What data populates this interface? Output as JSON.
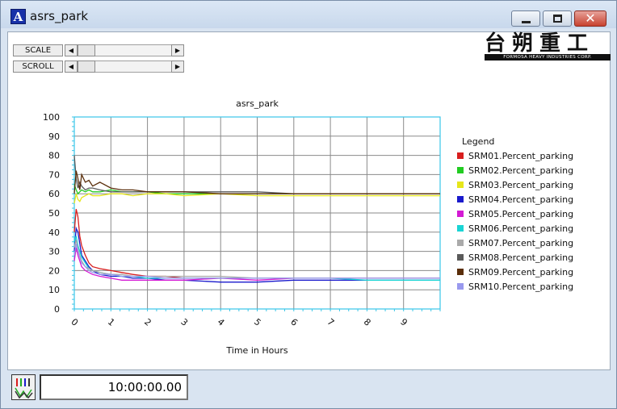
{
  "window": {
    "title": "asrs_park"
  },
  "controls": {
    "scale_label": "SCALE",
    "scroll_label": "SCROLL"
  },
  "logo": {
    "cjk": "台朔重工",
    "en": "FORMOSA HEAVY INDUSTRIES CORP."
  },
  "status": {
    "time": "10:00:00.00"
  },
  "colors": {
    "titlebar": "#c8d8ec",
    "plot_border": "#39c6e8",
    "close_button": "#c8422f"
  },
  "chart_data": {
    "type": "line",
    "title": "asrs_park",
    "xlabel": "Time in Hours",
    "ylabel": "",
    "xlim": [
      0,
      10
    ],
    "ylim": [
      0,
      100
    ],
    "x_ticks": [
      "0",
      "1",
      "2",
      "3",
      "4",
      "5",
      "6",
      "7",
      "8",
      "9"
    ],
    "y_ticks": [
      "0",
      "10",
      "20",
      "30",
      "40",
      "50",
      "60",
      "70",
      "80",
      "90",
      "100"
    ],
    "grid": true,
    "legend": {
      "title": "Legend",
      "placement": "right"
    },
    "x": [
      0,
      0.05,
      0.1,
      0.15,
      0.2,
      0.3,
      0.4,
      0.5,
      0.7,
      1.0,
      1.3,
      1.6,
      2.0,
      2.5,
      3.0,
      4.0,
      5.0,
      6.0,
      7.0,
      8.0,
      9.0,
      10.0
    ],
    "series": [
      {
        "name": "SRM01.Percent_parking",
        "color": "#d81e1e",
        "values": [
          40,
          52,
          48,
          38,
          33,
          28,
          24,
          22,
          21,
          20,
          19,
          18,
          17,
          17,
          16,
          16,
          16,
          16,
          16,
          16,
          16,
          16
        ]
      },
      {
        "name": "SRM02.Percent_parking",
        "color": "#22cc22",
        "values": [
          65,
          62,
          60,
          61,
          62,
          61,
          62,
          61,
          61,
          62,
          61,
          61,
          61,
          60,
          60,
          60,
          60,
          60,
          60,
          60,
          60,
          60
        ]
      },
      {
        "name": "SRM03.Percent_parking",
        "color": "#e6e61a",
        "values": [
          55,
          60,
          57,
          56,
          58,
          59,
          60,
          59,
          59,
          60,
          60,
          59,
          60,
          60,
          59,
          60,
          59,
          59,
          59,
          59,
          59,
          59
        ]
      },
      {
        "name": "SRM04.Percent_parking",
        "color": "#1a1acc",
        "values": [
          30,
          42,
          40,
          34,
          28,
          25,
          22,
          20,
          18,
          17,
          17,
          16,
          16,
          15,
          15,
          14,
          14,
          15,
          15,
          15,
          15,
          15
        ]
      },
      {
        "name": "SRM05.Percent_parking",
        "color": "#d41ad4",
        "values": [
          25,
          32,
          28,
          25,
          22,
          20,
          19,
          18,
          17,
          16,
          15,
          15,
          15,
          15,
          15,
          16,
          15,
          16,
          16,
          16,
          16,
          16
        ]
      },
      {
        "name": "SRM06.Percent_parking",
        "color": "#1ad4d4",
        "values": [
          35,
          38,
          33,
          30,
          27,
          24,
          21,
          20,
          19,
          18,
          17,
          17,
          16,
          16,
          16,
          16,
          16,
          16,
          16,
          15,
          15,
          15
        ]
      },
      {
        "name": "SRM07.Percent_parking",
        "color": "#aaaaaa",
        "values": [
          32,
          36,
          31,
          28,
          25,
          22,
          21,
          20,
          19,
          18,
          18,
          17,
          17,
          17,
          17,
          17,
          16,
          16,
          16,
          16,
          16,
          16
        ]
      },
      {
        "name": "SRM08.Percent_parking",
        "color": "#5a5a5a",
        "values": [
          80,
          68,
          63,
          66,
          64,
          62,
          63,
          63,
          62,
          61,
          61,
          61,
          61,
          61,
          61,
          61,
          61,
          60,
          60,
          60,
          60,
          60
        ]
      },
      {
        "name": "SRM09.Percent_parking",
        "color": "#5a2e0a",
        "values": [
          60,
          72,
          68,
          62,
          70,
          66,
          67,
          64,
          66,
          63,
          62,
          62,
          61,
          61,
          61,
          60,
          60,
          60,
          60,
          60,
          60,
          60
        ]
      },
      {
        "name": "SRM10.Percent_parking",
        "color": "#9999ee",
        "values": [
          28,
          34,
          30,
          27,
          24,
          22,
          20,
          19,
          18,
          18,
          17,
          17,
          17,
          16,
          16,
          16,
          16,
          16,
          16,
          16,
          16,
          16
        ]
      }
    ]
  }
}
